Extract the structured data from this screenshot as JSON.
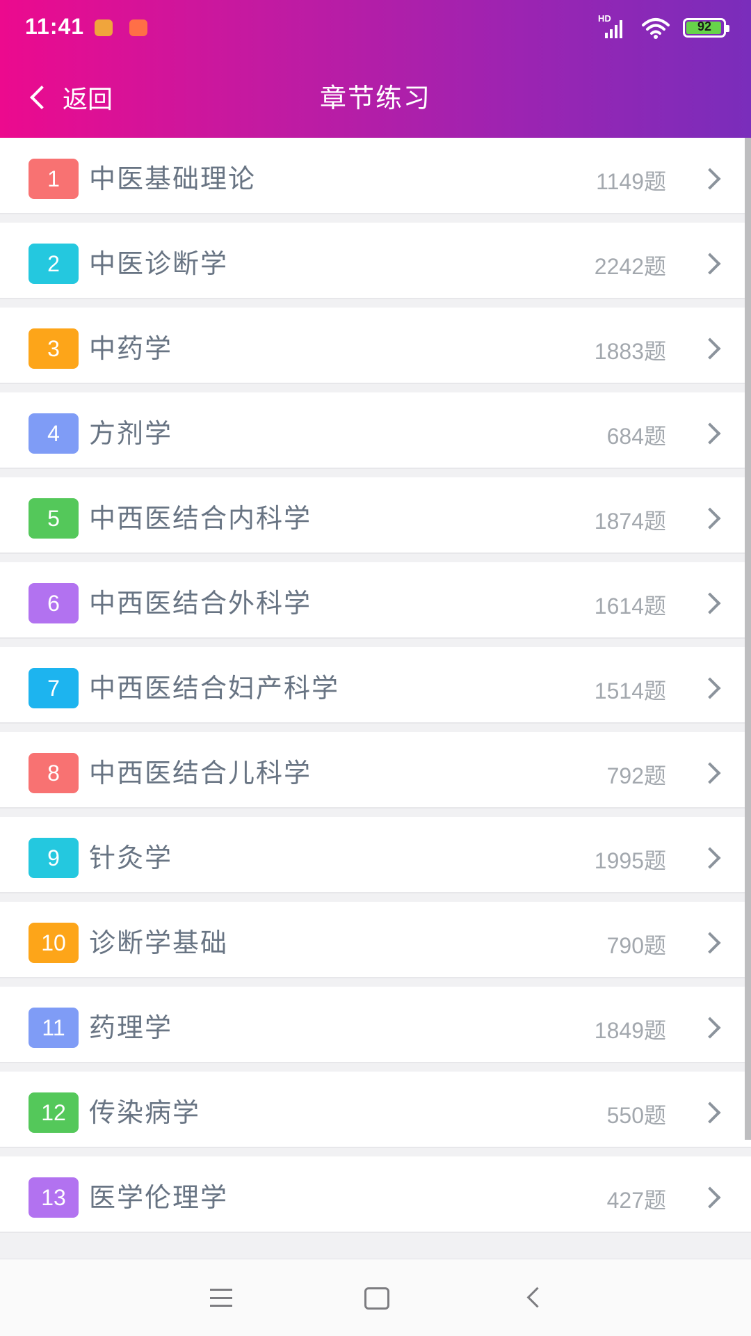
{
  "status_bar": {
    "time": "11:41",
    "network_label": "HD",
    "battery_level": "92"
  },
  "nav": {
    "back_label": "返回",
    "title": "章节练习"
  },
  "colors": {
    "gradient_start": "#ec0a8e",
    "gradient_end": "#7a2dbb",
    "badge_red": "#f87272",
    "badge_cyan": "#24c8df",
    "badge_orange": "#fda519",
    "badge_blue": "#7f9cf6",
    "badge_green": "#54c85a",
    "badge_purple": "#b272f0",
    "badge_sky": "#1db4ef"
  },
  "chapters": [
    {
      "number": "1",
      "title": "中医基础理论",
      "count": "1149题",
      "color": "#f87272"
    },
    {
      "number": "2",
      "title": "中医诊断学",
      "count": "2242题",
      "color": "#24c8df"
    },
    {
      "number": "3",
      "title": "中药学",
      "count": "1883题",
      "color": "#fda519"
    },
    {
      "number": "4",
      "title": "方剂学",
      "count": "684题",
      "color": "#7f9cf6"
    },
    {
      "number": "5",
      "title": "中西医结合内科学",
      "count": "1874题",
      "color": "#54c85a"
    },
    {
      "number": "6",
      "title": "中西医结合外科学",
      "count": "1614题",
      "color": "#b272f0"
    },
    {
      "number": "7",
      "title": "中西医结合妇产科学",
      "count": "1514题",
      "color": "#1db4ef"
    },
    {
      "number": "8",
      "title": "中西医结合儿科学",
      "count": "792题",
      "color": "#f87272"
    },
    {
      "number": "9",
      "title": "针灸学",
      "count": "1995题",
      "color": "#24c8df"
    },
    {
      "number": "10",
      "title": "诊断学基础",
      "count": "790题",
      "color": "#fda519"
    },
    {
      "number": "11",
      "title": "药理学",
      "count": "1849题",
      "color": "#7f9cf6"
    },
    {
      "number": "12",
      "title": "传染病学",
      "count": "550题",
      "color": "#54c85a"
    },
    {
      "number": "13",
      "title": "医学伦理学",
      "count": "427题",
      "color": "#b272f0"
    }
  ]
}
